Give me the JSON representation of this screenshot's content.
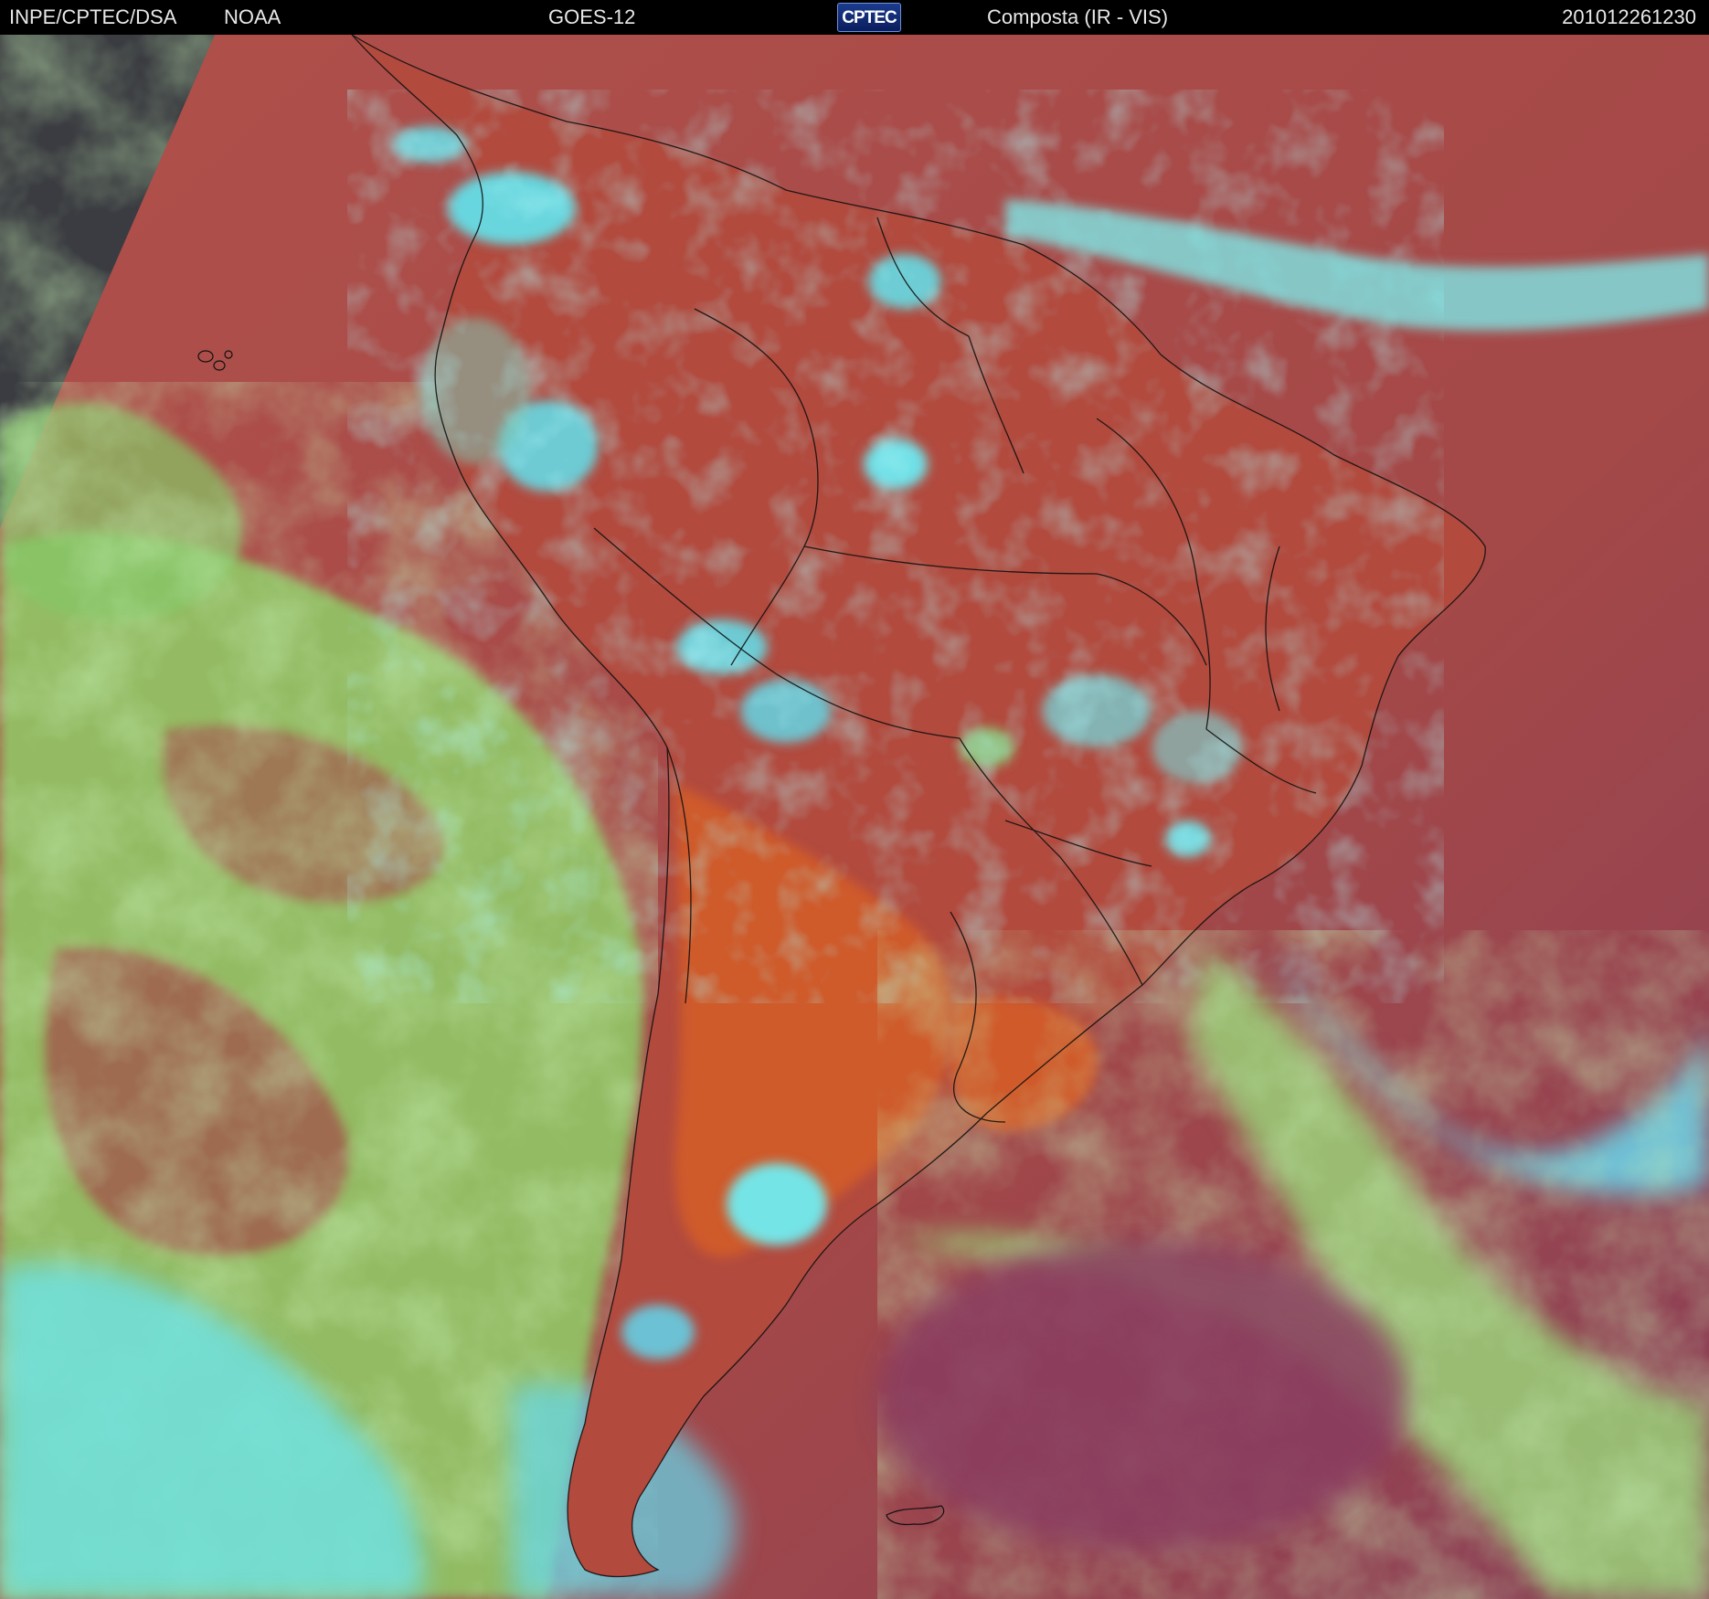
{
  "header": {
    "organization": "INPE/CPTEC/DSA",
    "agency": "NOAA",
    "satellite": "GOES-12",
    "logo_text": "CPTEC",
    "product": "Composta (IR - VIS)",
    "timestamp": "201012261230"
  },
  "colors": {
    "header_background": "#000000",
    "header_text": "#e8e8e8",
    "land_clear": "#c2512e",
    "ocean_clear": "#a84a48",
    "low_cloud": "#8fd36a",
    "high_cloud": "#66e8ee",
    "off_disk": "#3a3b40",
    "border_lines": "#111111"
  },
  "image": {
    "kind": "satellite-composite",
    "region_icon": "south-america-map"
  }
}
